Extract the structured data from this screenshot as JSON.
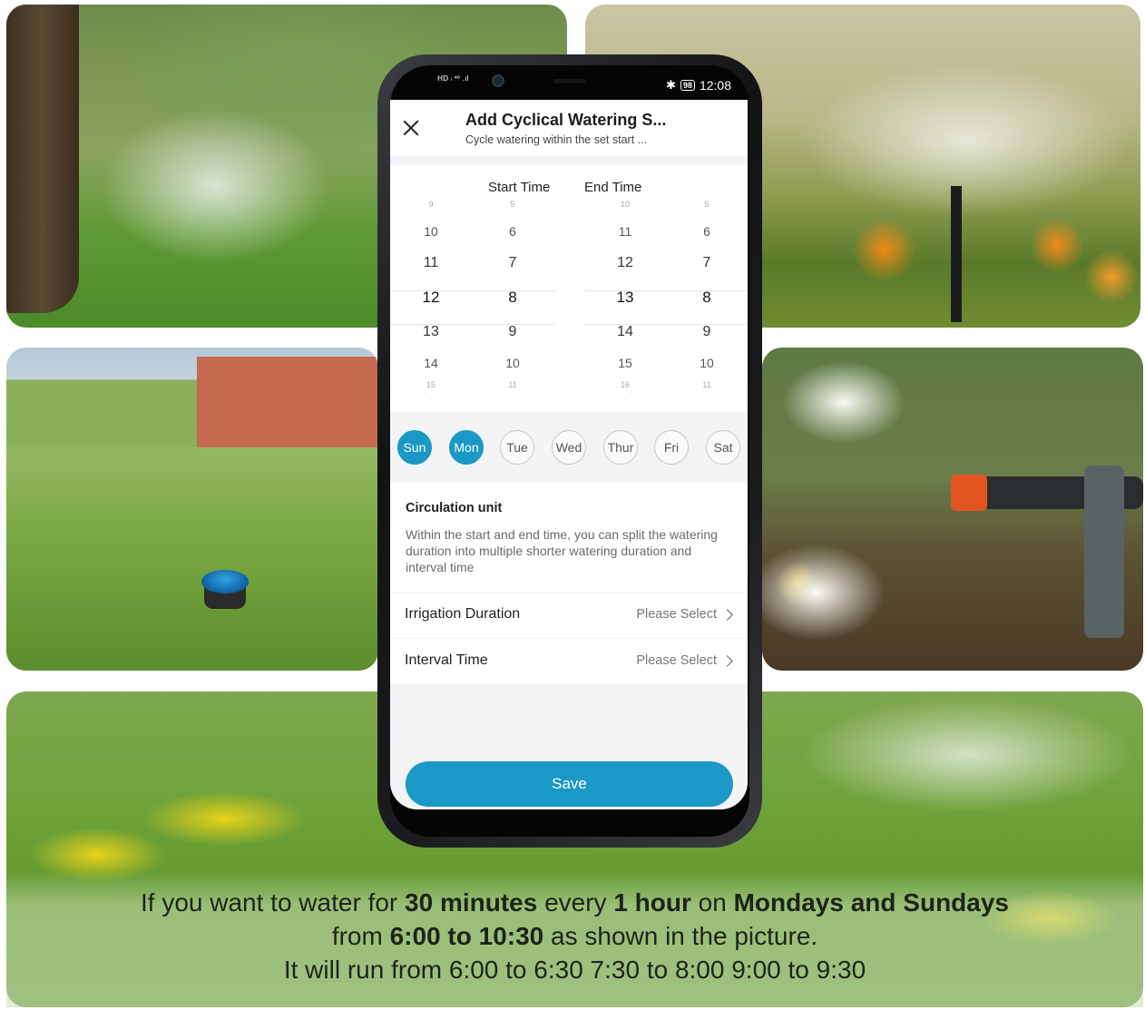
{
  "statusbar": {
    "left": "HD ᵢ ⁴⁶ .ıl",
    "time": "12:08",
    "battery": "98",
    "bluetooth": "✱"
  },
  "header": {
    "title": "Add Cyclical Watering S...",
    "subtitle": "Cycle watering within the set start ..."
  },
  "picker": {
    "start_label": "Start Time",
    "end_label": "End Time",
    "start_hours": [
      "-",
      "9",
      "10",
      "11",
      "12",
      "13",
      "14",
      "15",
      "-"
    ],
    "start_minutes": [
      "-",
      "5",
      "6",
      "7",
      "8",
      "9",
      "10",
      "11",
      "-"
    ],
    "end_hours": [
      "-",
      "10",
      "11",
      "12",
      "13",
      "14",
      "15",
      "16",
      "-"
    ],
    "end_minutes": [
      "-",
      "5",
      "6",
      "7",
      "8",
      "9",
      "10",
      "11",
      "-"
    ]
  },
  "days": [
    {
      "label": "Sun",
      "selected": true
    },
    {
      "label": "Mon",
      "selected": true
    },
    {
      "label": "Tue",
      "selected": false
    },
    {
      "label": "Wed",
      "selected": false
    },
    {
      "label": "Thur",
      "selected": false
    },
    {
      "label": "Fri",
      "selected": false
    },
    {
      "label": "Sat",
      "selected": false
    }
  ],
  "circulation": {
    "title": "Circulation unit",
    "description": "Within the start and end time, you can split the watering duration into multiple shorter watering duration and interval time"
  },
  "rows": {
    "irrigation_label": "Irrigation Duration",
    "irrigation_value": "Please Select",
    "interval_label": "Interval Time",
    "interval_value": "Please Select"
  },
  "save_label": "Save",
  "caption": {
    "l1_a": "If you want to water for ",
    "l1_b": "30 minutes",
    "l1_c": " every ",
    "l1_d": "1 hour",
    "l1_e": " on ",
    "l1_f": "Mondays and Sundays",
    "l2_a": "from ",
    "l2_b": "6:00 to 10:30",
    "l2_c": " as shown in the picture.",
    "l3": "It will run from 6:00 to 6:30 7:30 to 8:00 9:00 to 9:30"
  },
  "colors": {
    "accent": "#1a98c6",
    "text": "#222222"
  }
}
